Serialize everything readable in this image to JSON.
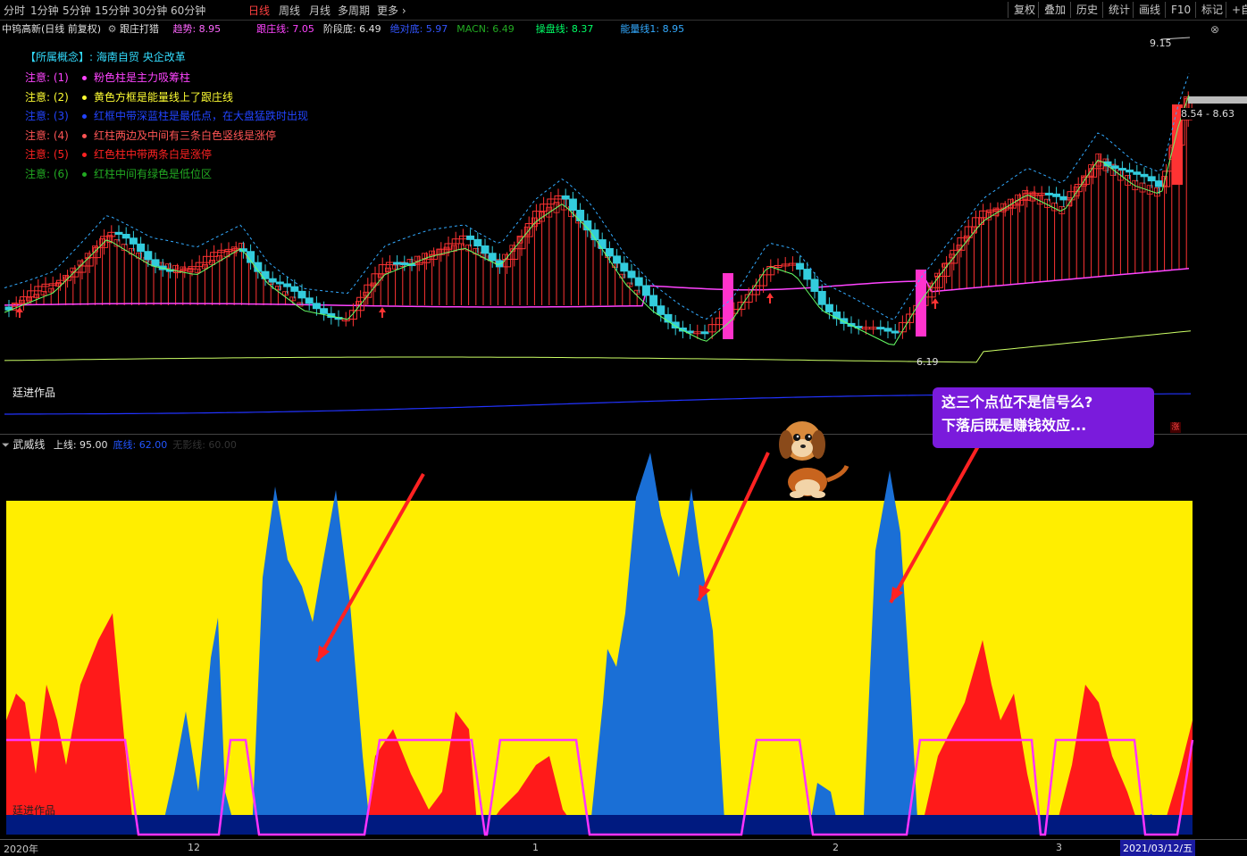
{
  "toolbar": {
    "periods": [
      "分时",
      "1分钟",
      "5分钟",
      "15分钟",
      "30分钟",
      "60分钟",
      "日线",
      "周线",
      "月线",
      "多周期",
      "更多"
    ],
    "active_period": "日线",
    "right_buttons": [
      "复权",
      "叠加",
      "历史",
      "统计",
      "画线",
      "F10",
      "标记",
      "+自"
    ]
  },
  "main_header": {
    "stock": "中钨高新(日线 前复权)",
    "indicator_name": "跟庄打猎",
    "items": [
      {
        "label": "趋势: 8.95",
        "color": "#ff66ff"
      },
      {
        "label": "跟庄线: 7.05",
        "color": "#ff44ff"
      },
      {
        "label": "阶段底: 6.49",
        "color": "#e0e0e0"
      },
      {
        "label": "绝对底: 5.97",
        "color": "#3355ff"
      },
      {
        "label": "MACN: 6.49",
        "color": "#22aa22"
      },
      {
        "label": "操盘线: 8.37",
        "color": "#00ff66"
      },
      {
        "label": "能量线1: 8.95",
        "color": "#33aaff"
      }
    ]
  },
  "concept": {
    "label": "【所属概念】:",
    "value": "海南自贸 央企改革"
  },
  "notes": [
    {
      "num": "注意: (1)",
      "text": "粉色柱是主力吸筹柱",
      "color": "#ff44ff"
    },
    {
      "num": "注意: (2)",
      "text": "黄色方框是能量线上了跟庄线",
      "color": "#ffff33"
    },
    {
      "num": "注意: (3)",
      "text": "红框中带深蓝柱是最低点，在大盘猛跌时出现",
      "color": "#2244ff"
    },
    {
      "num": "注意: (4)",
      "text": "红柱两边及中间有三条白色竖线是涨停",
      "color": "#ff5555"
    },
    {
      "num": "注意: (5)",
      "text": "红色柱中带两条白是涨停",
      "color": "#ff2222"
    },
    {
      "num": "注意: (6)",
      "text": "红柱中间有绿色是低位区",
      "color": "#22aa22"
    }
  ],
  "price_labels": {
    "high": "9.15",
    "right": "8.54 - 8.63",
    "low": "6.19"
  },
  "watermark": "廷进作品",
  "indicator_header": {
    "name": "武威线",
    "items": [
      {
        "label": "上线: 95.00",
        "color": "#e0e0e0"
      },
      {
        "label": "底线: 62.00",
        "color": "#2255ff"
      },
      {
        "label": "无影线: 60.00",
        "color": "#333333"
      }
    ]
  },
  "callout": {
    "line1": "这三个点位不是信号么?",
    "line2": "下落后既是赚钱效应..."
  },
  "xaxis": {
    "labels": [
      "2020年",
      "12",
      "1",
      "2",
      "3"
    ],
    "date_badge": "2021/03/12/五"
  },
  "colors": {
    "up": "#ff3333",
    "down": "#33ccdd",
    "pink": "#ff33cc",
    "yellow": "#ffee00",
    "blue": "#1a6fd6",
    "navy": "#001a80",
    "magenta_line": "#ff33ff"
  }
}
